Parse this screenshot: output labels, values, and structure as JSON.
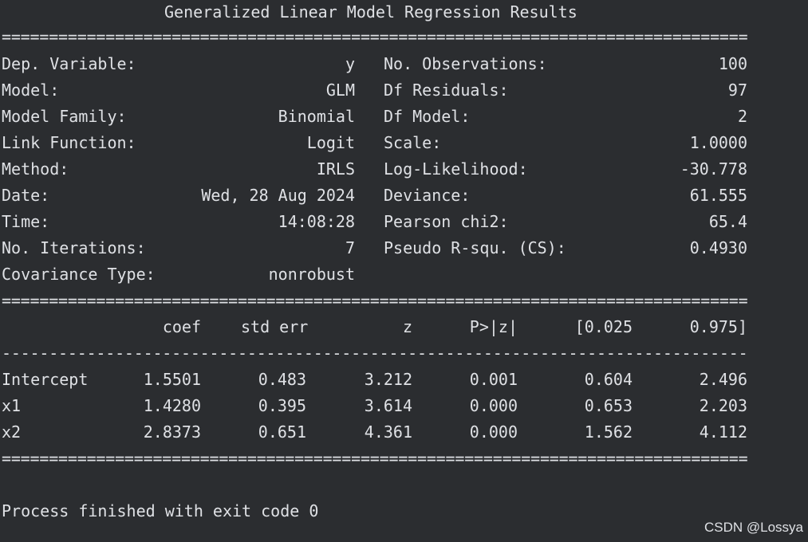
{
  "title": "Generalized Linear Model Regression Results",
  "rule_double": "=====================================================================================",
  "rule_single": "-------------------------------------------------------------------------------------",
  "summary": [
    {
      "left_label": "Dep. Variable:",
      "left_value": "y",
      "right_label": "No. Observations:",
      "right_value": "100"
    },
    {
      "left_label": "Model:",
      "left_value": "GLM",
      "right_label": "Df Residuals:",
      "right_value": "97"
    },
    {
      "left_label": "Model Family:",
      "left_value": "Binomial",
      "right_label": "Df Model:",
      "right_value": "2"
    },
    {
      "left_label": "Link Function:",
      "left_value": "Logit",
      "right_label": "Scale:",
      "right_value": "1.0000"
    },
    {
      "left_label": "Method:",
      "left_value": "IRLS",
      "right_label": "Log-Likelihood:",
      "right_value": "-30.778"
    },
    {
      "left_label": "Date:",
      "left_value": "Wed, 28 Aug 2024",
      "right_label": "Deviance:",
      "right_value": "61.555"
    },
    {
      "left_label": "Time:",
      "left_value": "14:08:28",
      "right_label": "Pearson chi2:",
      "right_value": "65.4"
    },
    {
      "left_label": "No. Iterations:",
      "left_value": "7",
      "right_label": "Pseudo R-squ. (CS):",
      "right_value": "0.4930"
    },
    {
      "left_label": "Covariance Type:",
      "left_value": "nonrobust",
      "right_label": "",
      "right_value": ""
    }
  ],
  "coef_headers": [
    "coef",
    "std err",
    "z",
    "P>|z|",
    "[0.025",
    "0.975]"
  ],
  "coef_rows": [
    {
      "name": "Intercept",
      "values": [
        "1.5501",
        "0.483",
        "3.212",
        "0.001",
        "0.604",
        "2.496"
      ]
    },
    {
      "name": "x1",
      "values": [
        "1.4280",
        "0.395",
        "3.614",
        "0.000",
        "0.653",
        "2.203"
      ]
    },
    {
      "name": "x2",
      "values": [
        "2.8373",
        "0.651",
        "4.361",
        "0.000",
        "1.562",
        "4.112"
      ]
    }
  ],
  "process_message": "Process finished with exit code 0",
  "watermark": "CSDN @Lossya"
}
